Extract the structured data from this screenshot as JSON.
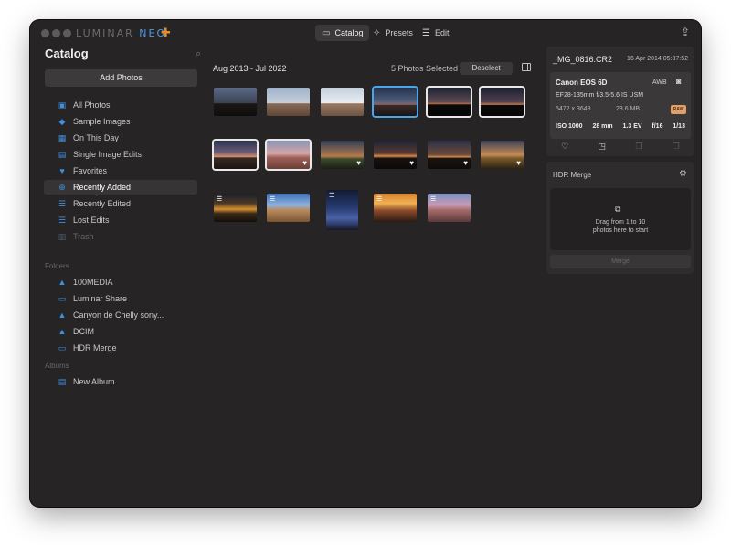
{
  "app": {
    "brand_left": "LUMINAR",
    "brand_right": "NEO",
    "brand_color": "#4a9be4"
  },
  "topnav": [
    {
      "label": "Catalog",
      "icon": "folder-icon",
      "active": true
    },
    {
      "label": "Presets",
      "icon": "sparkle-icon",
      "active": false
    },
    {
      "label": "Edit",
      "icon": "sliders-icon",
      "active": false
    }
  ],
  "sidebar": {
    "title": "Catalog",
    "add_photos_label": "Add Photos",
    "items": [
      {
        "label": "All Photos",
        "icon": "photos-icon"
      },
      {
        "label": "Sample Images",
        "icon": "graduation-cap-icon"
      },
      {
        "label": "On This Day",
        "icon": "calendar-icon"
      },
      {
        "label": "Single Image Edits",
        "icon": "grid-icon"
      },
      {
        "label": "Favorites",
        "icon": "heart-icon"
      },
      {
        "label": "Recently Added",
        "icon": "plus-circle-icon",
        "selected": true
      },
      {
        "label": "Recently Edited",
        "icon": "sliders-icon"
      },
      {
        "label": "Lost Edits",
        "icon": "sliders-icon"
      },
      {
        "label": "Trash",
        "icon": "trash-icon",
        "disabled": true
      }
    ],
    "folders_label": "Folders",
    "folders": [
      {
        "label": "100MEDIA",
        "icon": "drive-icon"
      },
      {
        "label": "Luminar Share",
        "icon": "folder-icon"
      },
      {
        "label": "Canyon de Chelly sony...",
        "icon": "drive-icon"
      },
      {
        "label": "DCIM",
        "icon": "drive-icon"
      },
      {
        "label": "HDR Merge",
        "icon": "folder-icon"
      }
    ],
    "albums_label": "Albums",
    "albums": [
      {
        "label": "New Album",
        "icon": "album-icon"
      }
    ]
  },
  "gallery": {
    "date_range": "Aug 2013 - Jul 2022",
    "selected_count": "5 Photos Selected",
    "deselect_label": "Deselect",
    "rows": [
      [
        {
          "bg": "linear-gradient(#5b6a85 0%, #3a4153 55%, #1b1714 56%, #0f0d0c 100%)",
          "state": "none"
        },
        {
          "bg": "linear-gradient(#9fb1c9 0%, #c7d0db 55%, #8a6b55 56%, #5e4638 100%)",
          "state": "none"
        },
        {
          "bg": "linear-gradient(#c4cfdb 0%, #e9eef3 55%, #9c7a60 56%, #6d5443 100%)",
          "state": "none"
        },
        {
          "bg": "linear-gradient(#24314a 0%, #4a5a7a 45%, #8b6a6a 60%, #3a2a2a 61%, #1b1515 100%)",
          "state": "active"
        },
        {
          "bg": "linear-gradient(#1d2232 0%, #5c4a52 50%, #b66a44 58%, #0a0a0a 60%, #050505 100%)",
          "state": "selected"
        },
        {
          "bg": "linear-gradient(#1c2030 0%, #514050 50%, #c0784a 60%, #0b0b0b 62%, #050505 100%)",
          "state": "selected"
        }
      ],
      [
        {
          "bg": "linear-gradient(#2b3350 0%, #6b5a75 40%, #d69168 58%, #3b2a25 60%, #1c1411 100%)",
          "state": "selected",
          "heart": false
        },
        {
          "bg": "linear-gradient(#8796b5 0%, #d4a5a8 45%, #9e5f57 60%, #6b3e35 100%)",
          "state": "selected",
          "heart": true
        },
        {
          "bg": "linear-gradient(#2f3d57 0%, #b57a4b 55%, #3a4a2b 65%, #1b1f13 100%)",
          "state": "none",
          "heart": true
        },
        {
          "bg": "linear-gradient(#1c2438 0%, #5c3a30 45%, #d7894a 55%, #181210 62%, #0b0908 100%)",
          "state": "none",
          "heart": true
        },
        {
          "bg": "linear-gradient(#2b3148 0%, #6e4a3a 50%, #cf8b4d 58%, #1a1410 62%, #0e0b09 100%)",
          "state": "none",
          "heart": true
        },
        {
          "bg": "linear-gradient(#3a4158 0%, #c78a55 50%, #7a5a2a 62%, #2a2210 100%)",
          "state": "none",
          "heart": true
        }
      ],
      [
        {
          "bg": "linear-gradient(#1d2028 0%, #4d3a28 35%, #d7902f 55%, #3a2a18 70%, #120e0a 100%)",
          "state": "none"
        },
        {
          "bg": "linear-gradient(#3d6fb8 0%, #8eb2df 40%, #b88a5e 58%, #7a5530 100%)",
          "state": "none"
        },
        {
          "bg": "linear-gradient(#121a33 0%, #283c72 45%, #4a62a8 70%, #15182a 100%)",
          "state": "none",
          "portrait": true
        },
        {
          "bg": "linear-gradient(#d9812e 0%, #f0b254 35%, #8c4a2a 60%, #2a1a14 100%)",
          "state": "none"
        },
        {
          "bg": "linear-gradient(#7a90c0 0%, #c79bb5 40%, #a56a6a 58%, #5b3a3a 100%)",
          "state": "none"
        }
      ]
    ]
  },
  "info": {
    "filename": "_MG_0816.CR2",
    "date": "16 Apr 2014 05:37:52",
    "camera": "Canon EOS 6D",
    "white_balance": "AWB",
    "lens": "EF28-135mm f/3.5-5.6 IS USM",
    "dimensions": "5472 x 3648",
    "file_size": "23.6 MB",
    "format_badge": "RAW",
    "iso": "ISO 1000",
    "focal_length": "28 mm",
    "exposure_comp": "1.3 EV",
    "aperture": "f/16",
    "shutter": "1/13"
  },
  "hdr": {
    "title": "HDR Merge",
    "drop_line1": "Drag from 1 to 10",
    "drop_line2": "photos here to start",
    "merge_label": "Merge"
  }
}
